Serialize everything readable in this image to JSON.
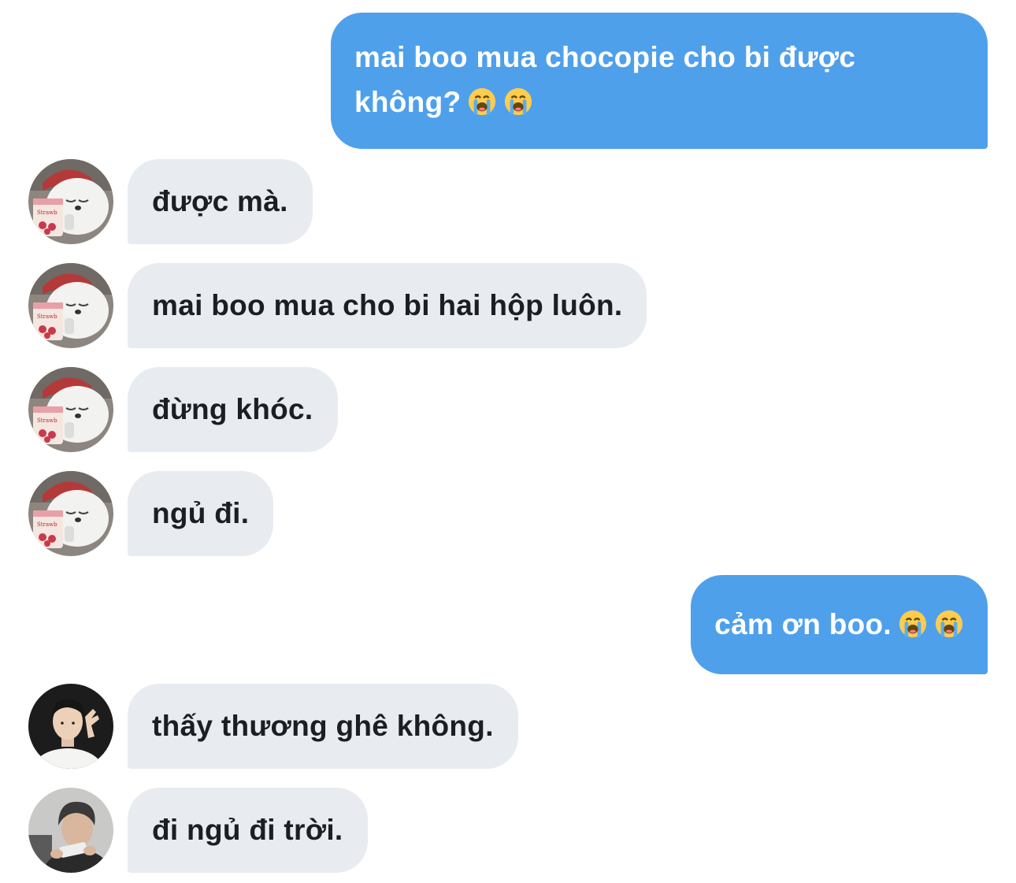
{
  "conversation": {
    "messages": [
      {
        "from": "me",
        "text": "mai boo mua chocopie cho bi được",
        "text2": "không?"
      },
      {
        "from": "boo",
        "text": "được mà."
      },
      {
        "from": "boo",
        "text": "mai boo mua cho bi hai hộp luôn."
      },
      {
        "from": "boo",
        "text": "đừng khóc."
      },
      {
        "from": "boo",
        "text": "ngủ đi."
      },
      {
        "from": "me",
        "text": "cảm ơn boo."
      },
      {
        "from": "guy1",
        "text": "thấy thương ghê không."
      },
      {
        "from": "guy2",
        "text": "đi ngủ đi trời."
      }
    ],
    "emoji_name": "loudly-crying-face",
    "colors": {
      "sent_bubble": "#4fa0eb",
      "received_bubble": "#e8ecf0",
      "sent_text": "#ffffff",
      "received_text": "#1b1f24"
    }
  }
}
